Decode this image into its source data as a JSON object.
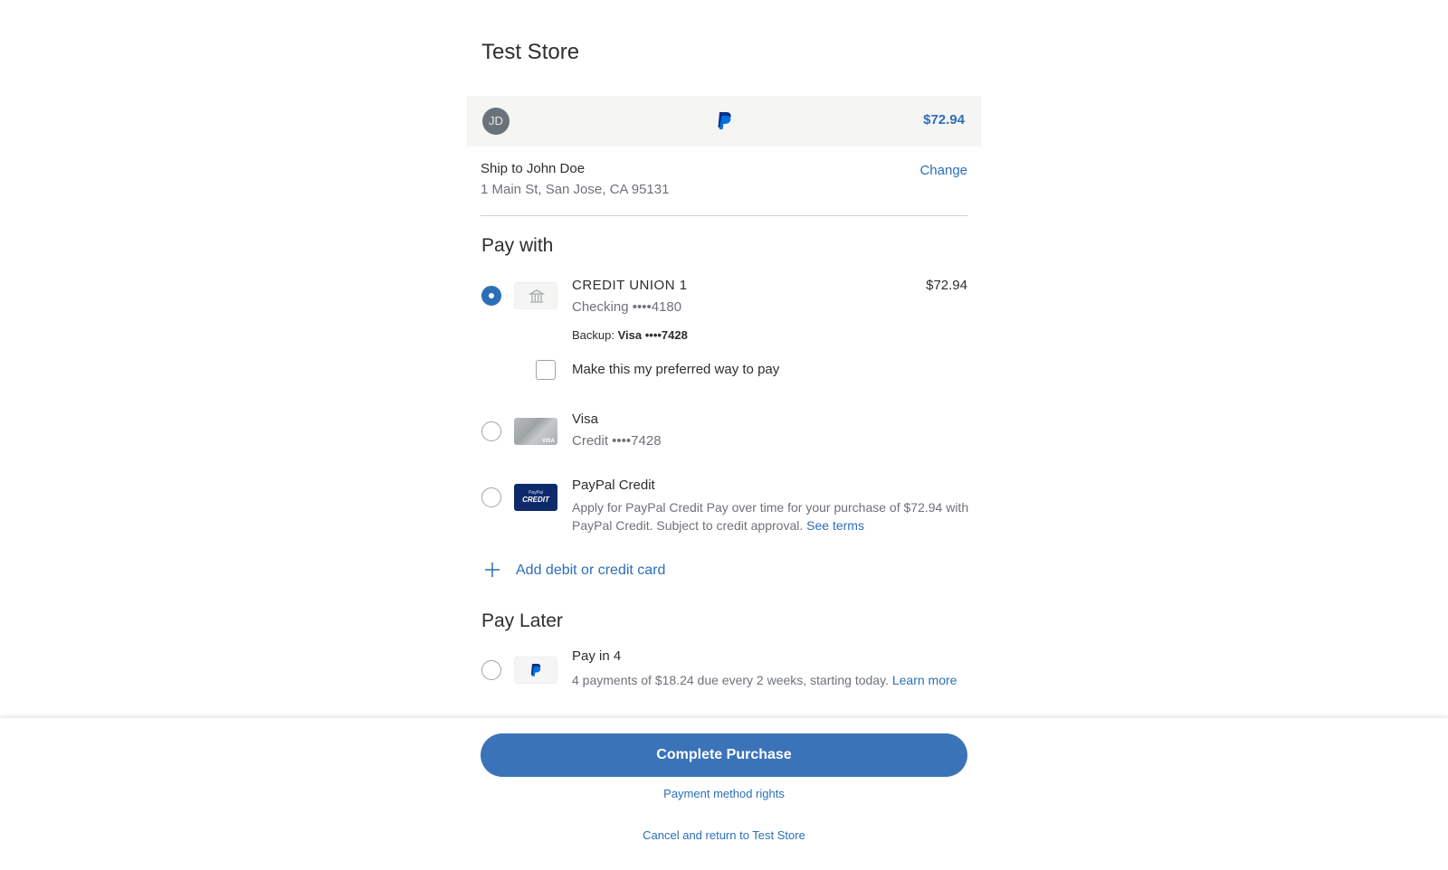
{
  "store": {
    "title": "Test Store"
  },
  "header": {
    "avatar_initials": "JD",
    "amount": "$72.94",
    "logo_icon": "paypal-logo-icon"
  },
  "shipping": {
    "name_line": "Ship to John Doe",
    "address": "1 Main St, San Jose, CA 95131",
    "change_label": "Change"
  },
  "pay_with": {
    "title": "Pay with",
    "methods": [
      {
        "name": "CREDIT UNION 1",
        "sub": "Checking ••••4180",
        "amount": "$72.94",
        "backup_label": "Backup:",
        "backup_value": "Visa ••••7428",
        "selected": true,
        "icon": "bank-icon"
      },
      {
        "name": "Visa",
        "sub": "Credit ••••7428",
        "selected": false,
        "icon": "visa-card-icon",
        "icon_text": "VISA"
      },
      {
        "name": "PayPal Credit",
        "desc": "Apply for PayPal Credit Pay over time for your purchase of $72.94 with PayPal Credit. Subject to credit approval.",
        "link": "See terms",
        "selected": false,
        "icon": "paypal-credit-icon",
        "icon_text_top": "PayPal",
        "icon_text_bottom": "CREDIT"
      }
    ],
    "preferred_checkbox_label": "Make this my preferred way to pay",
    "preferred_checked": false,
    "add_card_label": "Add debit or credit card"
  },
  "pay_later": {
    "title": "Pay Later",
    "method": {
      "name": "Pay in 4",
      "desc": "4 payments of $18.24 due every 2 weeks, starting today.",
      "link": "Learn more",
      "selected": false,
      "icon": "paypal-icon"
    }
  },
  "footer": {
    "complete_label": "Complete Purchase",
    "rights_label": "Payment method rights",
    "cancel_label": "Cancel and return to Test Store"
  },
  "colors": {
    "accent": "#2c6fb7",
    "button": "#3b73b9",
    "text": "#2c2e2f",
    "muted": "#6c7378",
    "header_bg": "#f5f5f3"
  }
}
